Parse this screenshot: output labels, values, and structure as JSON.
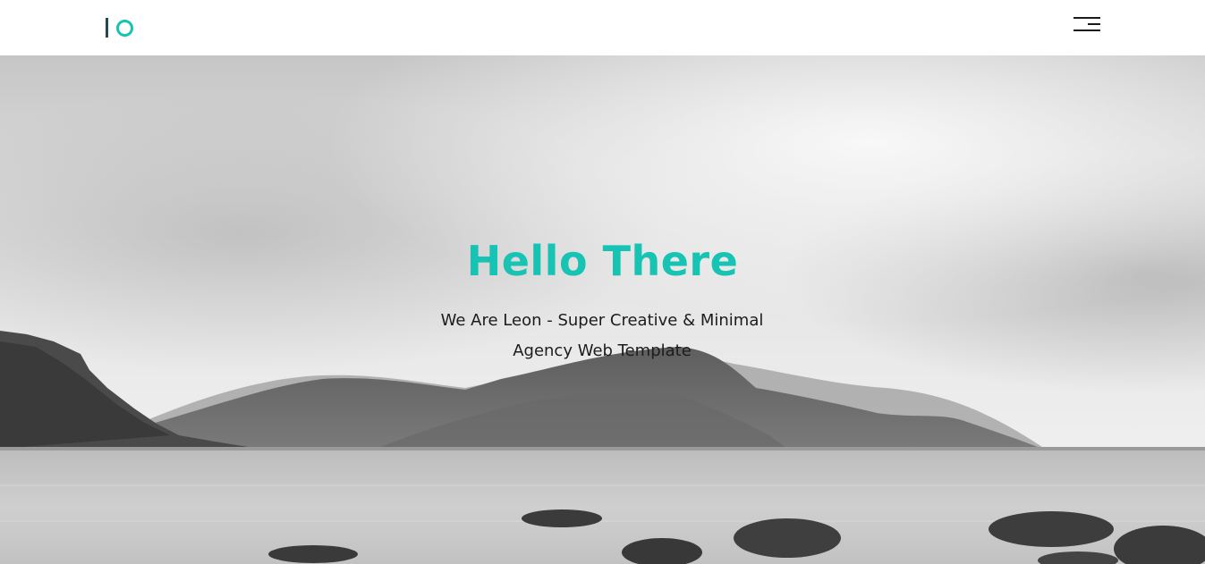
{
  "header": {
    "logo_name": "IO logo",
    "menu_icon": "hamburger-menu-icon"
  },
  "hero": {
    "title": "Hello There",
    "subtitle": "We Are Leon - Super Creative & Minimal Agency Web Template",
    "background": "monochrome coastal landscape photo"
  },
  "colors": {
    "accent": "#17c3b2",
    "logo_dark": "#1f4a52",
    "text": "#1c1c1c",
    "header_bg": "#ffffff"
  }
}
